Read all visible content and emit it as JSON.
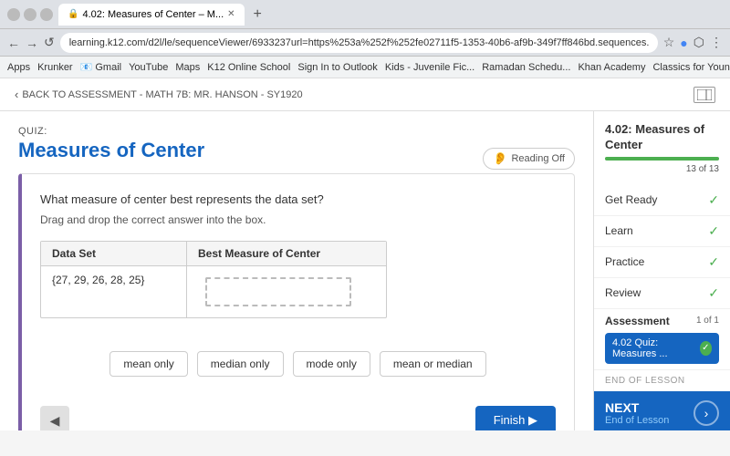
{
  "browser": {
    "tab_title": "4.02: Measures of Center – M...",
    "url": "learning.k12.com/d2l/le/sequenceViewer/6933237url=https%253a%252f%252fe02711f5-1353-40b6-af9b-349f7ff846bd.sequences.api.brightspace.com%252f...",
    "bookmarks": [
      "Apps",
      "Krunker",
      "Gmail",
      "YouTube",
      "Maps",
      "K12 Online School",
      "Sign In to Outlook",
      "Kids - Juvenile Fic...",
      "Ramadan Schedu...",
      "Khan Academy",
      "Classics for Youn..."
    ]
  },
  "top_nav": {
    "back_label": "BACK TO ASSESSMENT - MATH 7B: MR. HANSON - SY1920"
  },
  "main": {
    "quiz_label": "QUIZ:",
    "quiz_title": "Measures of Center",
    "reading_toggle": "Reading  Off",
    "question_text": "What measure of center best represents the data set?",
    "drag_instruction": "Drag and drop the correct answer into the box.",
    "table": {
      "headers": [
        "Data Set",
        "Best Measure of Center"
      ],
      "rows": [
        [
          "{27, 29, 26, 28, 25}",
          ""
        ]
      ]
    },
    "answer_choices": [
      "mean only",
      "median only",
      "mode only",
      "mean or median"
    ],
    "prev_btn": "◀",
    "finish_btn": "Finish ▶"
  },
  "sidebar": {
    "title": "4.02: Measures of\nCenter",
    "progress_label": "13 of 13",
    "progress_percent": 100,
    "items": [
      {
        "label": "Get Ready",
        "checked": true
      },
      {
        "label": "Learn",
        "checked": true
      },
      {
        "label": "Practice",
        "checked": true
      },
      {
        "label": "Review",
        "checked": true
      }
    ],
    "assessment": {
      "label": "Assessment",
      "count": "1 of 1",
      "item_label": "4.02 Quiz: Measures ...",
      "item_checked": true
    },
    "end_of_lesson": "END OF LESSON",
    "next": {
      "label": "NEXT",
      "sublabel": "End of Lesson"
    }
  }
}
